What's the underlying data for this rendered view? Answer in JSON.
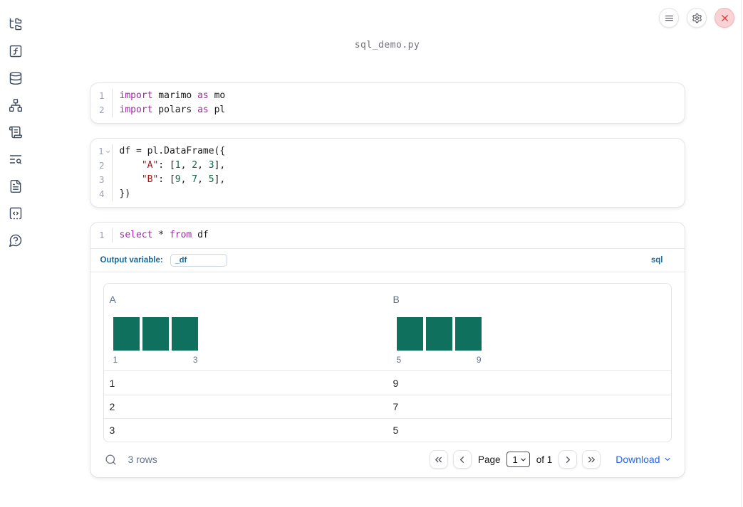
{
  "window": {
    "title": "sql_demo.py"
  },
  "colors": {
    "sql_accent": "#16699d",
    "link_blue": "#2563eb",
    "histogram_bar": "#0f705d",
    "danger_red": "#d64545",
    "syntax_keyword": "#a325a8",
    "syntax_string": "#a31515",
    "syntax_number": "#116644"
  },
  "topbar": {
    "buttons": [
      {
        "name": "menu-button",
        "icon": "menu-icon",
        "danger": false
      },
      {
        "name": "settings-button",
        "icon": "gear-icon",
        "danger": false
      },
      {
        "name": "shutdown-button",
        "icon": "close-icon",
        "danger": true
      }
    ]
  },
  "sidebar": {
    "items": [
      {
        "name": "panel-file-explorer",
        "icon": "file-tree-icon"
      },
      {
        "name": "panel-variables",
        "icon": "function-square-icon"
      },
      {
        "name": "panel-data-sources",
        "icon": "database-icon"
      },
      {
        "name": "panel-dependency-graph",
        "icon": "network-icon"
      },
      {
        "name": "panel-logs",
        "icon": "scroll-icon"
      },
      {
        "name": "panel-outline-search",
        "icon": "list-search-icon"
      },
      {
        "name": "panel-documentation",
        "icon": "file-text-icon"
      },
      {
        "name": "panel-snippets",
        "icon": "code-box-icon"
      },
      {
        "name": "panel-help",
        "icon": "help-bubble-icon"
      }
    ]
  },
  "cells": [
    {
      "type": "code",
      "lines": [
        {
          "num": "1",
          "fold": false,
          "tokens": [
            [
              "kw",
              "import"
            ],
            [
              "tx",
              " marimo "
            ],
            [
              "kw",
              "as"
            ],
            [
              "tx",
              " mo"
            ]
          ]
        },
        {
          "num": "2",
          "fold": false,
          "tokens": [
            [
              "kw",
              "import"
            ],
            [
              "tx",
              " polars "
            ],
            [
              "kw",
              "as"
            ],
            [
              "tx",
              " pl"
            ]
          ]
        }
      ]
    },
    {
      "type": "code",
      "lines": [
        {
          "num": "1",
          "fold": true,
          "tokens": [
            [
              "tx",
              "df = pl.DataFrame({"
            ]
          ]
        },
        {
          "num": "2",
          "fold": false,
          "tokens": [
            [
              "tx",
              "    "
            ],
            [
              "str",
              "\"A\""
            ],
            [
              "tx",
              ": ["
            ],
            [
              "num",
              "1"
            ],
            [
              "tx",
              ", "
            ],
            [
              "num",
              "2"
            ],
            [
              "tx",
              ", "
            ],
            [
              "num",
              "3"
            ],
            [
              "tx",
              "],"
            ]
          ]
        },
        {
          "num": "3",
          "fold": false,
          "tokens": [
            [
              "tx",
              "    "
            ],
            [
              "str",
              "\"B\""
            ],
            [
              "tx",
              ": ["
            ],
            [
              "num",
              "9"
            ],
            [
              "tx",
              ", "
            ],
            [
              "num",
              "7"
            ],
            [
              "tx",
              ", "
            ],
            [
              "num",
              "5"
            ],
            [
              "tx",
              "],"
            ]
          ]
        },
        {
          "num": "4",
          "fold": false,
          "tokens": [
            [
              "tx",
              "})"
            ]
          ]
        }
      ]
    },
    {
      "type": "sql",
      "lines": [
        {
          "num": "1",
          "fold": false,
          "tokens": [
            [
              "kw",
              "select"
            ],
            [
              "tx",
              " * "
            ],
            [
              "kw",
              "from"
            ],
            [
              "tx",
              " df"
            ]
          ]
        }
      ],
      "output_variable_label": "Output variable:",
      "output_variable_value": "_df",
      "language_badge": "sql"
    }
  ],
  "table": {
    "columns": [
      {
        "name": "A",
        "histogram": {
          "bars": [
            1,
            1,
            1
          ],
          "min_label": "1",
          "max_label": "3"
        }
      },
      {
        "name": "B",
        "histogram": {
          "bars": [
            1,
            1,
            1
          ],
          "min_label": "5",
          "max_label": "9"
        }
      }
    ],
    "rows": [
      [
        "1",
        "9"
      ],
      [
        "2",
        "7"
      ],
      [
        "3",
        "5"
      ]
    ],
    "footer": {
      "row_count": "3 rows",
      "page_label": "Page",
      "page_value": "1",
      "of_label": "of 1",
      "download_label": "Download"
    }
  }
}
